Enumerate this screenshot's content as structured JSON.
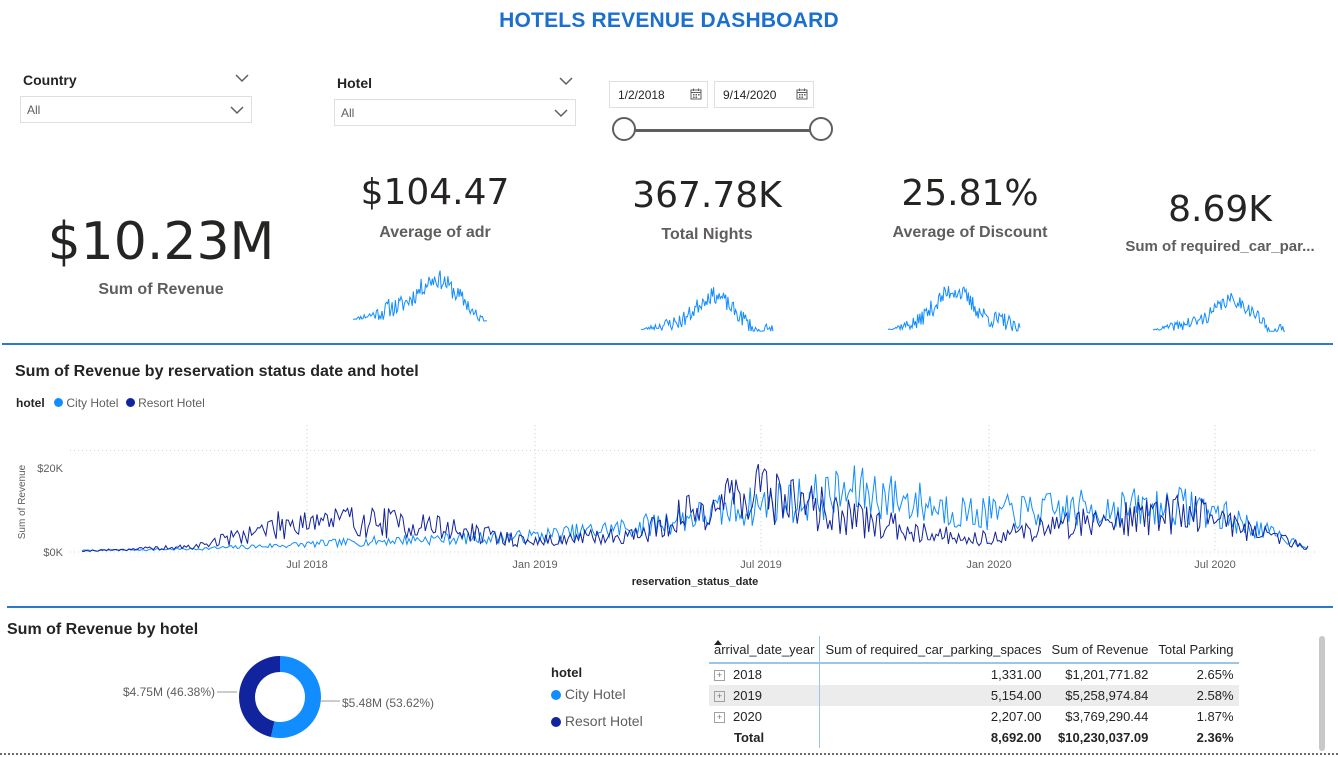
{
  "title": "HOTELS REVENUE  DASHBOARD",
  "filters": {
    "country": {
      "label": "Country",
      "value": "All"
    },
    "hotel": {
      "label": "Hotel",
      "value": "All"
    },
    "date_start": "1/2/2018",
    "date_end": "9/14/2020"
  },
  "kpis": {
    "revenue": {
      "value": "$10.23M",
      "label": "Sum of Revenue"
    },
    "adr": {
      "value": "$104.47",
      "label": "Average of adr"
    },
    "nights": {
      "value": "367.78K",
      "label": "Total Nights"
    },
    "discount": {
      "value": "25.81%",
      "label": "Average of Discount"
    },
    "parking": {
      "value": "8.69K",
      "label": "Sum of required_car_par..."
    }
  },
  "line_chart": {
    "title": "Sum of Revenue by reservation status date and hotel",
    "legend_title": "hotel",
    "ylabel": "Sum of Revenue",
    "xlabel": "reservation_status_date",
    "yticks": [
      "$20K",
      "$0K"
    ],
    "xticks": [
      "Jul 2018",
      "Jan 2019",
      "Jul 2019",
      "Jan 2020",
      "Jul 2020"
    ]
  },
  "donut": {
    "title": "Sum of Revenue by hotel",
    "legend_title": "hotel",
    "label_resort": "$4.75M (46.38%)",
    "label_city": "$5.48M (53.62%)"
  },
  "table": {
    "headers": [
      "arrival_date_year",
      "Sum of required_car_parking_spaces",
      "Sum of Revenue",
      "Total Parking"
    ],
    "rows": [
      [
        "2018",
        "1,331.00",
        "$1,201,771.82",
        "2.65%"
      ],
      [
        "2019",
        "5,154.00",
        "$5,258,974.84",
        "2.58%"
      ],
      [
        "2020",
        "2,207.00",
        "$3,769,290.44",
        "1.87%"
      ]
    ],
    "total": [
      "Total",
      "8,692.00",
      "$10,230,037.09",
      "2.36%"
    ]
  },
  "colors": {
    "city": "#118dff",
    "resort": "#12239e",
    "accent": "#1a6fcf"
  },
  "chart_data": [
    {
      "type": "line",
      "title": "Sum of Revenue by reservation status date and hotel",
      "xlabel": "reservation_status_date",
      "ylabel": "Sum of Revenue",
      "x": [
        "Jan 2018",
        "Apr 2018",
        "Jul 2018",
        "Oct 2018",
        "Jan 2019",
        "Apr 2019",
        "Jul 2019",
        "Oct 2019",
        "Jan 2020",
        "Apr 2020",
        "Jul 2020",
        "Sep 2020"
      ],
      "series": [
        {
          "name": "City Hotel",
          "values": [
            300,
            600,
            1500,
            2500,
            3000,
            5000,
            9000,
            12000,
            7500,
            8500,
            9000,
            1000
          ]
        },
        {
          "name": "Resort Hotel",
          "values": [
            200,
            1000,
            6500,
            5500,
            2000,
            3500,
            12500,
            6000,
            2500,
            6000,
            8000,
            900
          ]
        }
      ],
      "ylim": [
        0,
        25000
      ],
      "yticks": [
        "$20K",
        "$0K"
      ],
      "xticks": [
        "Jul 2018",
        "Jan 2019",
        "Jul 2019",
        "Jan 2020",
        "Jul 2020"
      ],
      "legend": "top-left",
      "grid": true
    },
    {
      "type": "pie",
      "title": "Sum of Revenue by hotel",
      "categories": [
        "City Hotel",
        "Resort Hotel"
      ],
      "values": [
        5.48,
        4.75
      ],
      "percent": [
        53.62,
        46.38
      ],
      "legend": "right"
    }
  ]
}
